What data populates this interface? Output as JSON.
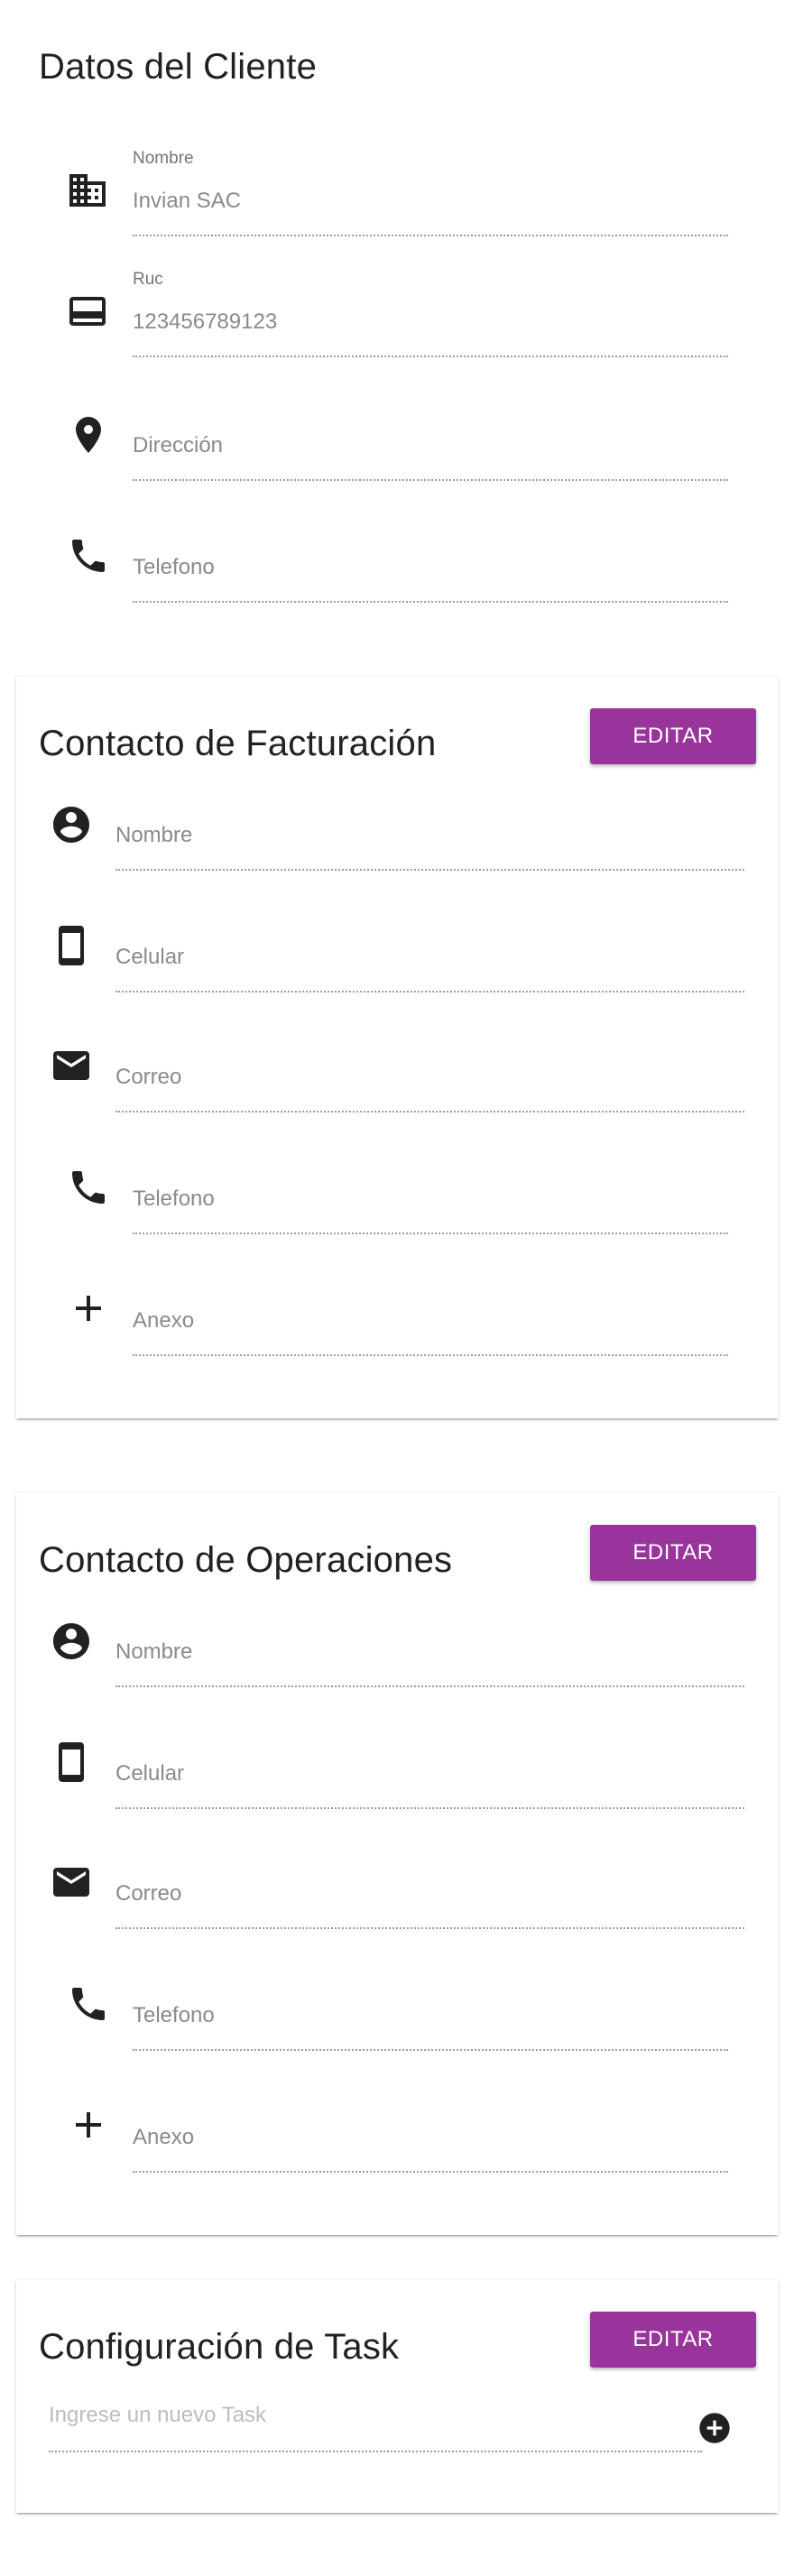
{
  "client": {
    "title": "Datos del Cliente",
    "fields": [
      {
        "label": "Nombre",
        "value": "Invian SAC"
      },
      {
        "label": "Ruc",
        "value": "123456789123"
      },
      {
        "label": "",
        "value": "Dirección"
      },
      {
        "label": "",
        "value": "Telefono"
      }
    ]
  },
  "billing": {
    "title": "Contacto de Facturación",
    "edit_label": "EDITAR",
    "fields": [
      "Nombre",
      "Celular",
      "Correo",
      "Telefono",
      "Anexo"
    ]
  },
  "operations": {
    "title": "Contacto de Operaciones",
    "edit_label": "EDITAR",
    "fields": [
      "Nombre",
      "Celular",
      "Correo",
      "Telefono",
      "Anexo"
    ]
  },
  "tasks": {
    "title": "Configuración de Task",
    "edit_label": "EDITAR",
    "input_placeholder": "Ingrese un nuevo Task"
  },
  "icons": {
    "client": [
      "business-icon",
      "credit-card-icon",
      "location-pin-icon",
      "phone-icon"
    ],
    "contact": [
      "account-circle-icon",
      "smartphone-icon",
      "mail-icon",
      "phone-icon",
      "plus-icon"
    ],
    "task_add": "add-circle-icon"
  },
  "colors": {
    "accent": "#98349c",
    "text": "#212121",
    "muted": "#8a8a8a"
  }
}
